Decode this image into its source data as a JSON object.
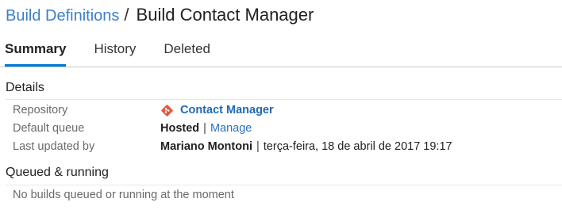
{
  "breadcrumb": {
    "parent_label": "Build Definitions",
    "separator": "/",
    "current_label": "Build Contact Manager"
  },
  "tabs": [
    {
      "label": "Summary",
      "active": true
    },
    {
      "label": "History",
      "active": false
    },
    {
      "label": "Deleted",
      "active": false
    }
  ],
  "details": {
    "title": "Details",
    "repository": {
      "label": "Repository",
      "value": "Contact Manager",
      "icon": "git-icon"
    },
    "default_queue": {
      "label": "Default queue",
      "value": "Hosted",
      "separator": "|",
      "action": "Manage"
    },
    "last_updated": {
      "label": "Last updated by",
      "user": "Mariano Montoni",
      "separator": "|",
      "date": "terça-feira, 18 de abril de 2017 19:17"
    }
  },
  "queued": {
    "title": "Queued & running",
    "empty_message": "No builds queued or running at the moment"
  },
  "colors": {
    "link": "#3c80c8",
    "tab_underline": "#0078d7",
    "git_icon": "#e2583e"
  }
}
